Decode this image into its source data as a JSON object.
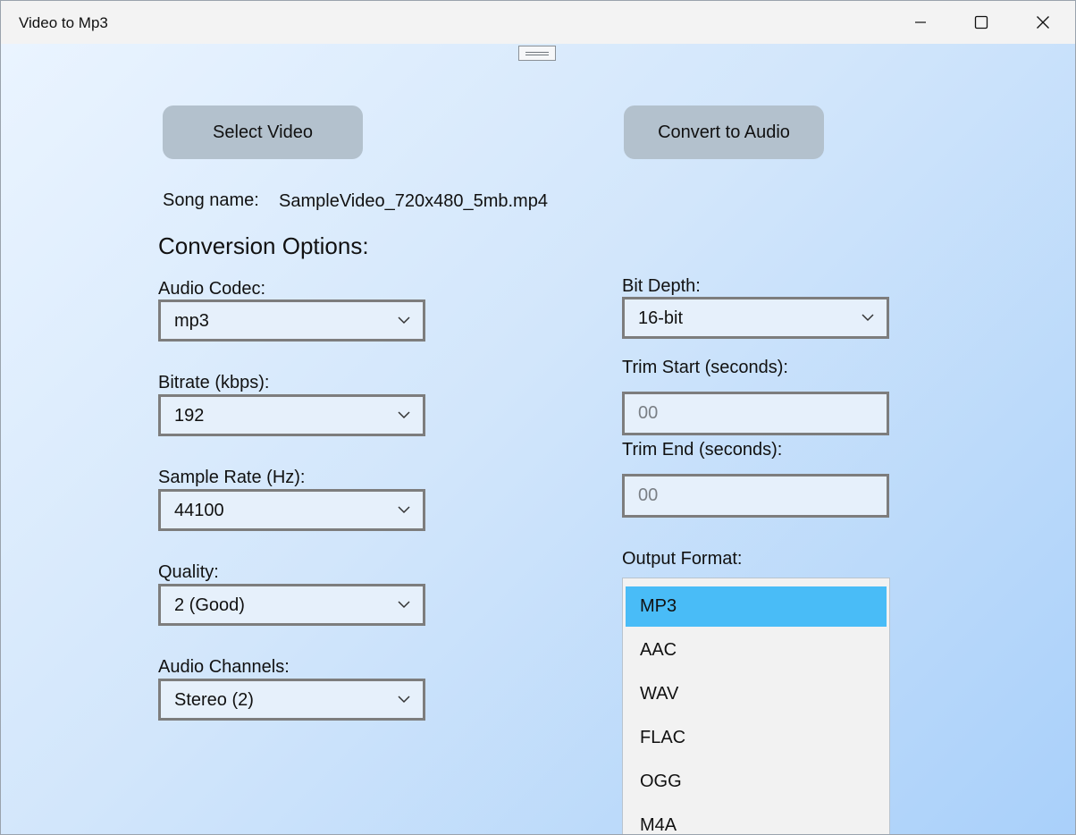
{
  "window": {
    "title": "Video to Mp3"
  },
  "actions": {
    "select_video": "Select Video",
    "convert": "Convert to Audio"
  },
  "song": {
    "label": "Song name:",
    "value": "SampleVideo_720x480_5mb.mp4"
  },
  "options": {
    "heading": "Conversion Options:",
    "audio_codec": {
      "label": "Audio Codec:",
      "value": "mp3"
    },
    "bitrate": {
      "label": "Bitrate (kbps):",
      "value": "192"
    },
    "sample_rate": {
      "label": "Sample Rate (Hz):",
      "value": "44100"
    },
    "quality": {
      "label": "Quality:",
      "value": "2 (Good)"
    },
    "channels": {
      "label": "Audio Channels:",
      "value": "Stereo (2)"
    },
    "bit_depth": {
      "label": "Bit Depth:",
      "value": "16-bit"
    },
    "trim_start": {
      "label": "Trim Start (seconds):",
      "placeholder": "00"
    },
    "trim_end": {
      "label": "Trim End (seconds):",
      "placeholder": "00"
    },
    "output_format": {
      "label": "Output Format:",
      "selected": "MP3",
      "items": [
        "MP3",
        "AAC",
        "WAV",
        "FLAC",
        "OGG",
        "M4A"
      ]
    }
  },
  "icons": {
    "minimize": "minimize-icon",
    "maximize": "maximize-icon",
    "close": "close-icon",
    "dropdown": "chevron-down-icon"
  },
  "colors": {
    "button": "#b3c1cd",
    "selection": "#49bcf7",
    "gradient_start": "#eaf4ff",
    "gradient_end": "#a9d0fa"
  }
}
